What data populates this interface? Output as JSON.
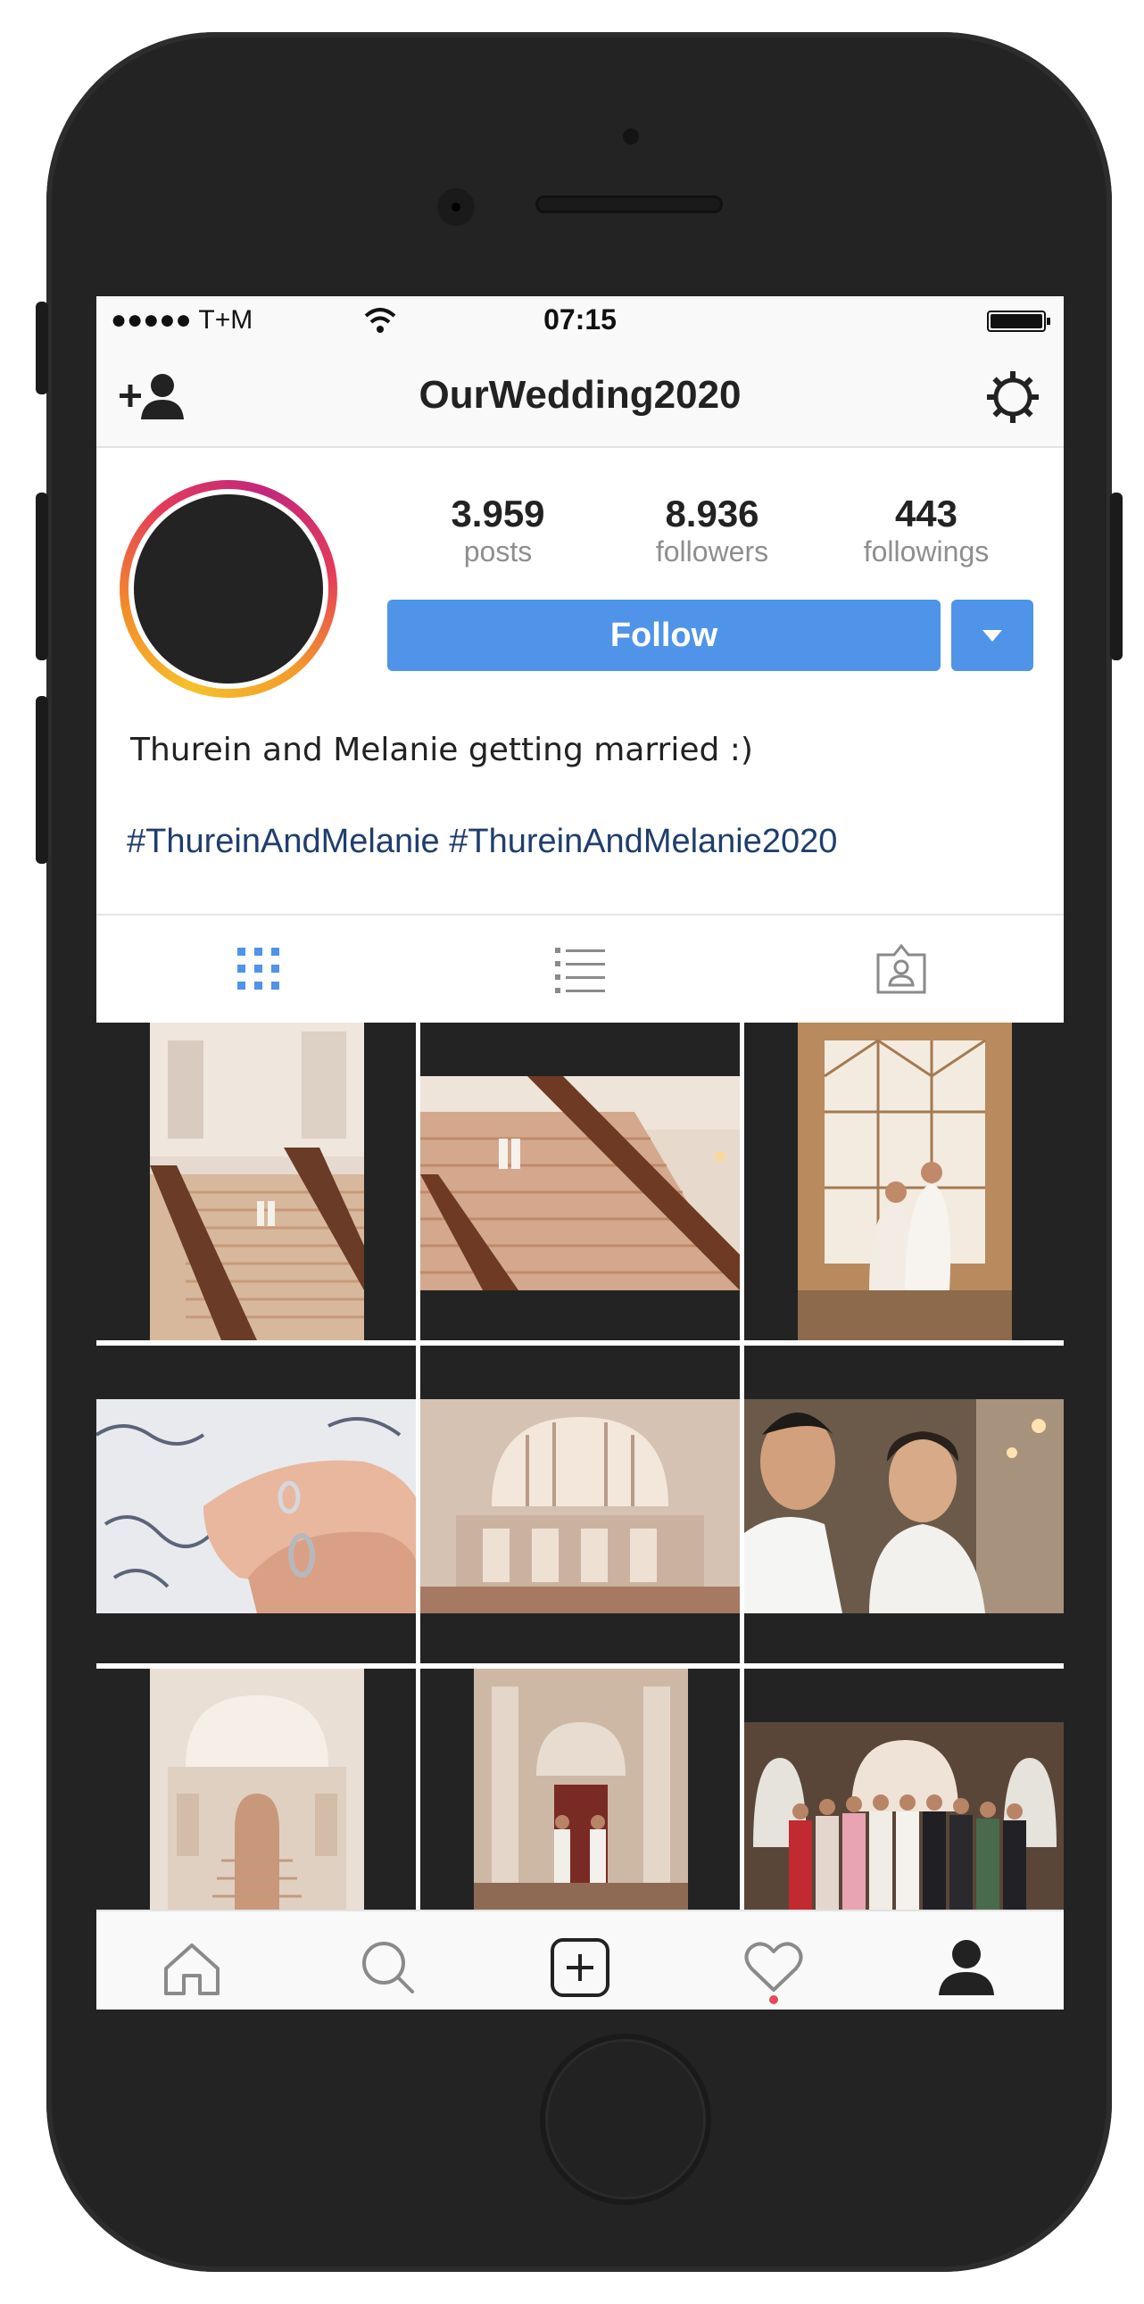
{
  "status_bar": {
    "carrier": "●●●●● T+M",
    "time": "07:15"
  },
  "header": {
    "title": "OurWedding2020",
    "icons": [
      "add-user-icon",
      "gear-icon"
    ]
  },
  "profile": {
    "stats": [
      {
        "value": "3.959",
        "label": "posts"
      },
      {
        "value": "8.936",
        "label": "followers"
      },
      {
        "value": "443",
        "label": "followings"
      }
    ],
    "follow_label": "Follow",
    "bio": "Thurein and Melanie getting married :)",
    "hashtags": "#ThureinAndMelanie #ThureinAndMelanie2020"
  },
  "tabs": [
    {
      "icon": "grid-icon",
      "active": true
    },
    {
      "icon": "list-icon",
      "active": false
    },
    {
      "icon": "tagged-icon",
      "active": false
    }
  ],
  "photos": [
    "grand-staircase-vertical",
    "grand-staircase-couple",
    "couple-by-window",
    "hands-with-rings",
    "rotunda-interior",
    "couple-close-up",
    "hall-staircase",
    "couple-in-doorway",
    "family-group-photo"
  ],
  "tab_bar": [
    "home-icon",
    "search-icon",
    "add-post-icon",
    "heart-icon",
    "profile-icon"
  ],
  "colors": {
    "accent": "#4f94e8",
    "hashtag": "#1f3e6e",
    "notification": "#e44b5a"
  }
}
